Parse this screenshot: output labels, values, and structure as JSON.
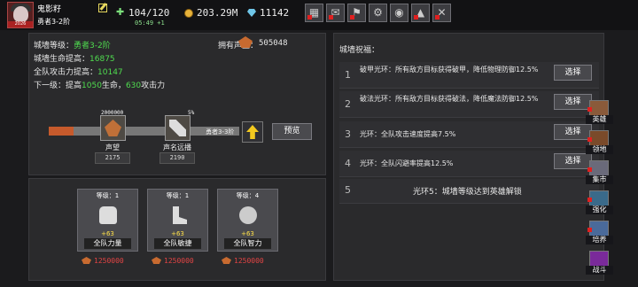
{
  "player": {
    "name": "鬼影籽",
    "title": "勇者3-2阶",
    "level_badge": "2026",
    "stamina": "104/120",
    "timer": "05:49 +1",
    "gold": "203.29M",
    "gems": "11142"
  },
  "topbar": {
    "buttons": [
      {
        "name": "shop",
        "glyph": "▦"
      },
      {
        "name": "mail",
        "glyph": "✉"
      },
      {
        "name": "tasks",
        "glyph": "⚑"
      },
      {
        "name": "settings",
        "glyph": "⚙"
      },
      {
        "name": "events",
        "glyph": "◉"
      },
      {
        "name": "rank",
        "glyph": "▲"
      },
      {
        "name": "battle",
        "glyph": "✕"
      }
    ]
  },
  "wall": {
    "level_label": "城墙等级：",
    "level_value": "勇者3-2阶",
    "hp_label": "城墙生命提高：",
    "hp_value": "16875",
    "atk_label": "全队攻击力提高：",
    "atk_value": "10147",
    "next_prefix": "下一级：提高",
    "next_hp": "1050",
    "next_mid": "生命，",
    "next_atk": "630",
    "next_suffix": "攻击力",
    "fame_label": "拥有声望：",
    "fame_value": "505048",
    "progress": 0.13,
    "milestones": [
      {
        "top": "2000000",
        "name": "声望",
        "value": "2175"
      },
      {
        "top": "5%",
        "name": "声名远播",
        "value": "2190"
      }
    ],
    "target_level": "勇者3-3阶",
    "preview_label": "预览"
  },
  "upgrades": [
    {
      "level": "等级：1",
      "bonus": "+63",
      "name": "全队力量",
      "cost": "1250000",
      "icon": "fist-icon"
    },
    {
      "level": "等级：1",
      "bonus": "+63",
      "name": "全队敏捷",
      "cost": "1250000",
      "icon": "foot-icon"
    },
    {
      "level": "等级：4",
      "bonus": "+63",
      "name": "全队智力",
      "cost": "1250000",
      "icon": "brain-icon"
    }
  ],
  "blessing": {
    "title": "城墙祝福：",
    "select_label": "选择",
    "rows": [
      {
        "num": "1",
        "text": "破甲光环：所有敌方目标获得破甲，降低物理防御12.5%"
      },
      {
        "num": "2",
        "text": "破法光环：所有敌方目标获得破法，降低魔法防御12.5%"
      },
      {
        "num": "3",
        "text": "光环：全队攻击速度提高7.5%"
      },
      {
        "num": "4",
        "text": "光环：全队闪避率提高12.5%"
      }
    ],
    "locked": {
      "num": "5",
      "text": "光环5：城墙等级达到英雄解锁"
    }
  },
  "sidebar": [
    {
      "label": "英雄",
      "color": "#8a5a3a"
    },
    {
      "label": "领地",
      "color": "#7a4a2a"
    },
    {
      "label": "集市",
      "color": "#6a6a7a"
    },
    {
      "label": "强化",
      "color": "#3a6a8a"
    },
    {
      "label": "培养",
      "color": "#4a6a9a"
    },
    {
      "label": "战斗",
      "color": "#7a2a9a"
    }
  ]
}
